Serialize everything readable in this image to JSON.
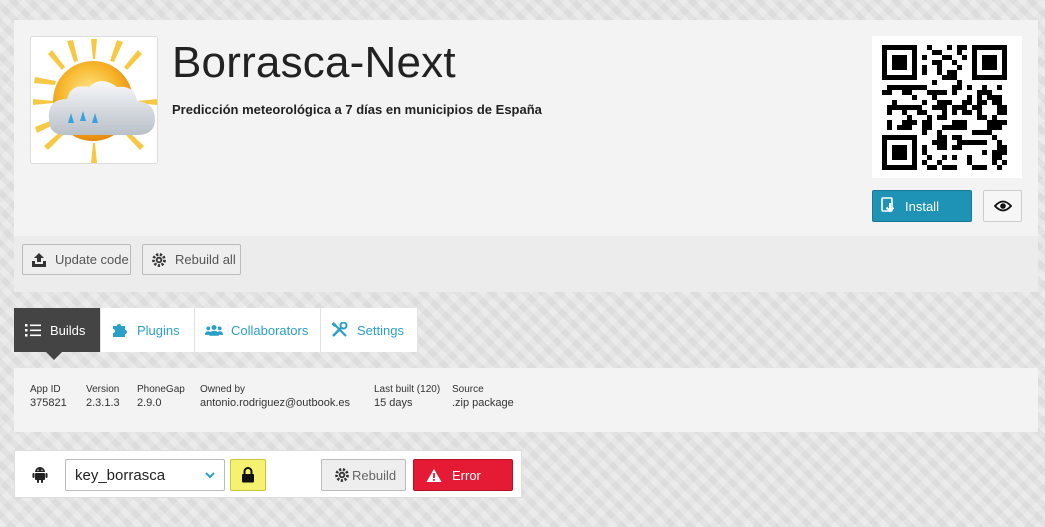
{
  "app": {
    "title": "Borrasca-Next",
    "description": "Predicción meteorológica a 7 días en municipios de España",
    "icon": "weather-sun-cloud-icon",
    "qr_icon": "qr-code-icon",
    "install_label": "Install",
    "preview_icon": "eye-icon"
  },
  "actions": {
    "update_code_label": "Update code",
    "rebuild_all_label": "Rebuild all"
  },
  "tabs": [
    {
      "label": "Builds",
      "icon": "list-icon",
      "active": true
    },
    {
      "label": "Plugins",
      "icon": "puzzle-icon",
      "active": false
    },
    {
      "label": "Collaborators",
      "icon": "users-icon",
      "active": false
    },
    {
      "label": "Settings",
      "icon": "wrench-screwdriver-icon",
      "active": false
    }
  ],
  "info": [
    {
      "key": "App ID",
      "value": "375821"
    },
    {
      "key": "Version",
      "value": "2.3.1.3"
    },
    {
      "key": "PhoneGap",
      "value": "2.9.0"
    },
    {
      "key": "Owned by",
      "value": "antonio.rodriguez@outbook.es"
    },
    {
      "key": "Last built (120)",
      "value": "15 days"
    },
    {
      "key": "Source",
      "value": ".zip package"
    }
  ],
  "build": {
    "platform_icon": "android-icon",
    "signing_key": "key_borrasca",
    "rebuild_label": "Rebuild",
    "status_label": "Error"
  },
  "colors": {
    "install": "#1e93b5",
    "error": "#e51b35",
    "lock": "#f4f270",
    "tab_link": "#2a9fc8",
    "tab_active": "#444444"
  }
}
